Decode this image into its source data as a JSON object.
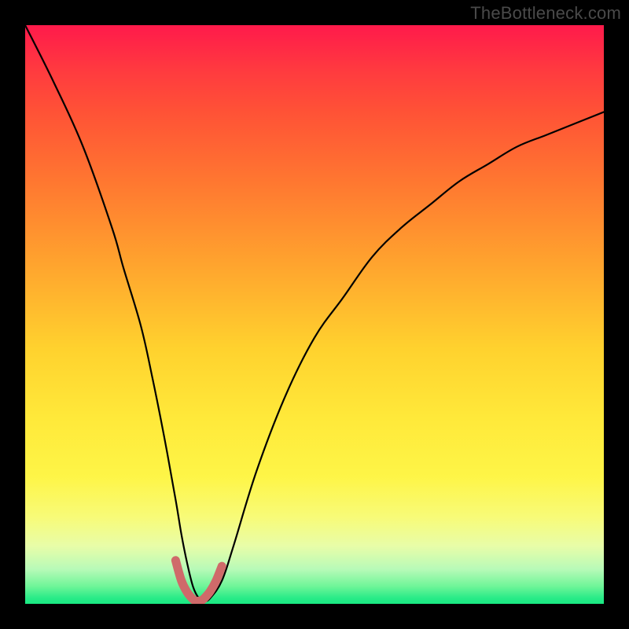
{
  "watermark": "TheBottleneck.com",
  "chart_data": {
    "type": "line",
    "title": "",
    "xlabel": "",
    "ylabel": "",
    "xlim": [
      0,
      100
    ],
    "ylim": [
      0,
      100
    ],
    "gradient_meaning": "vertical color gradient from green (near 0, bottom) through yellow to red (near 100, top) — appears to encode bottleneck severity",
    "series": [
      {
        "name": "bottleneck-curve-main",
        "x": [
          0,
          5,
          10,
          15,
          17,
          20,
          22,
          24,
          26,
          27,
          28,
          29,
          30,
          31,
          32,
          34,
          36,
          40,
          45,
          50,
          55,
          60,
          65,
          70,
          75,
          80,
          85,
          90,
          95,
          100
        ],
        "y": [
          100,
          90,
          79,
          65,
          58,
          48,
          39,
          29,
          18,
          12,
          7,
          3,
          1,
          0.5,
          1,
          4,
          10,
          23,
          36,
          46,
          53,
          60,
          65,
          69,
          73,
          76,
          79,
          81,
          83,
          85
        ]
      },
      {
        "name": "trough-highlight",
        "color": "#cf6a6a",
        "x": [
          26,
          27,
          28,
          29,
          29.5,
          30,
          30.5,
          31,
          32,
          33,
          34
        ],
        "y": [
          7.5,
          4,
          2,
          0.8,
          0.5,
          0.5,
          0.6,
          1,
          2.2,
          4,
          6.5
        ]
      }
    ]
  }
}
